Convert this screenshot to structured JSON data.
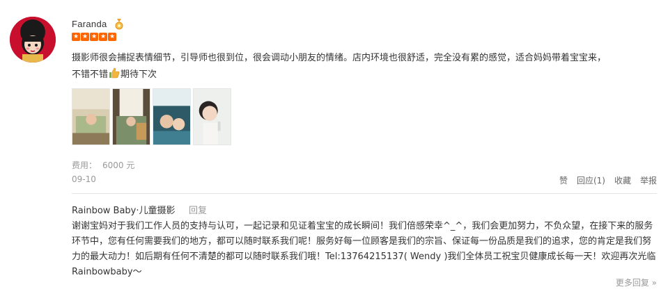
{
  "review": {
    "username": "Faranda",
    "rating": 5,
    "text_line1": "摄影师很会捕捉表情细节，引导师也很到位，很会调动小朋友的情绪。店内环境也很舒适，完全没有累的感觉，适合妈妈带着宝宝来，",
    "text_line2_before": "不错不错",
    "text_line2_after": "期待下次",
    "fee_label": "费用：",
    "fee_value": "6000 元",
    "date": "09-10",
    "photo_count": 4
  },
  "actions": {
    "like": "赞",
    "reply": "回应(1)",
    "favorite": "收藏",
    "report": "举报"
  },
  "merchant_reply": {
    "name": "Rainbow Baby·儿童摄影",
    "reply_label": "回复",
    "text": "谢谢宝妈对于我们工作人员的支持与认可，一起记录和见证着宝宝的成长瞬间！我们倍感荣幸^_^，我们会更加努力，不负众望，在接下来的服务环节中，您有任何需要我们的地方，都可以随时联系我们呢！服务好每一位顾客是我们的宗旨、保证每一份品质是我们的追求，您的肯定是我们努力的最大动力！如后期有任何不清楚的都可以随时联系我们哦！Tel:13764215137( Wendy )我们全体员工祝宝贝健康成长每一天！欢迎再次光临Rainbowbaby～"
  },
  "more_replies": "更多回复 »",
  "colors": {
    "star": "#ff6600",
    "muted": "#999999",
    "text": "#333333",
    "avatar_bg": "#c8102e"
  }
}
